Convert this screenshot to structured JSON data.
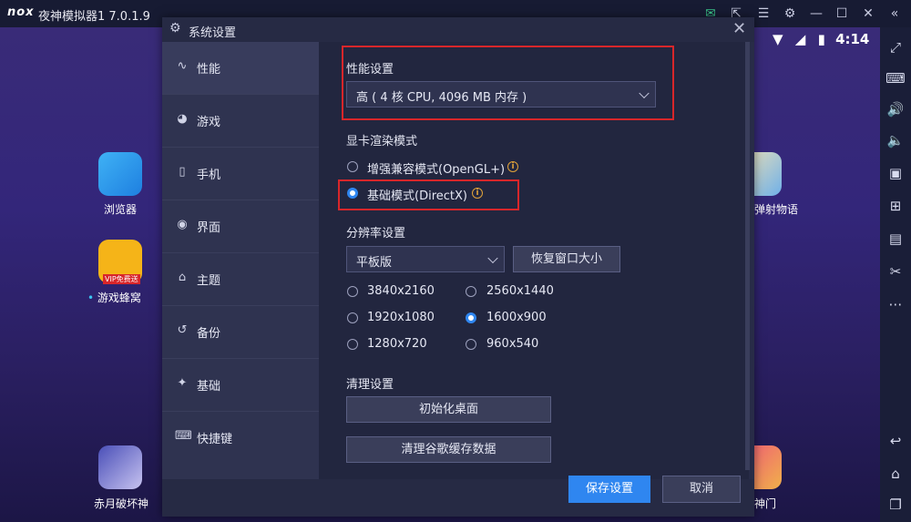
{
  "app": {
    "logo": "nox",
    "title": "夜神模拟器1 7.0.1.9"
  },
  "status": {
    "time": "4:14"
  },
  "desktop_apps": [
    {
      "label": "浏览器"
    },
    {
      "label": "游戏蜂窝",
      "badge": "VIP免费送"
    },
    {
      "label": "赤月破坏神"
    },
    {
      "label": "弹射物语"
    },
    {
      "label": "神门"
    }
  ],
  "dialog": {
    "title": "系统设置",
    "nav": [
      {
        "label": "性能",
        "icon": "performance-icon"
      },
      {
        "label": "游戏",
        "icon": "game-icon"
      },
      {
        "label": "手机",
        "icon": "phone-icon"
      },
      {
        "label": "界面",
        "icon": "interface-icon"
      },
      {
        "label": "主题",
        "icon": "theme-icon"
      },
      {
        "label": "备份",
        "icon": "backup-icon"
      },
      {
        "label": "基础",
        "icon": "basic-icon"
      },
      {
        "label": "快捷键",
        "icon": "shortcut-icon"
      }
    ],
    "performance": {
      "heading": "性能设置",
      "value": "高 ( 4 核 CPU, 4096 MB 内存 )"
    },
    "render": {
      "heading": "显卡渲染模式",
      "opt1": "增强兼容模式(OpenGL+)",
      "opt2": "基础模式(DirectX)",
      "selected": "基础模式(DirectX)"
    },
    "resolution": {
      "heading": "分辨率设置",
      "preset": "平板版",
      "restore_label": "恢复窗口大小",
      "options": [
        "3840x2160",
        "2560x1440",
        "1920x1080",
        "1600x900",
        "1280x720",
        "960x540"
      ],
      "selected": "1600x900"
    },
    "cleanup": {
      "heading": "清理设置",
      "init_desktop": "初始化桌面",
      "clear_cache": "清理谷歌缓存数据"
    },
    "save_label": "保存设置",
    "cancel_label": "取消"
  },
  "colors": {
    "accent": "#2f86f0",
    "highlight": "#d8262a",
    "info": "#e0a23a"
  }
}
